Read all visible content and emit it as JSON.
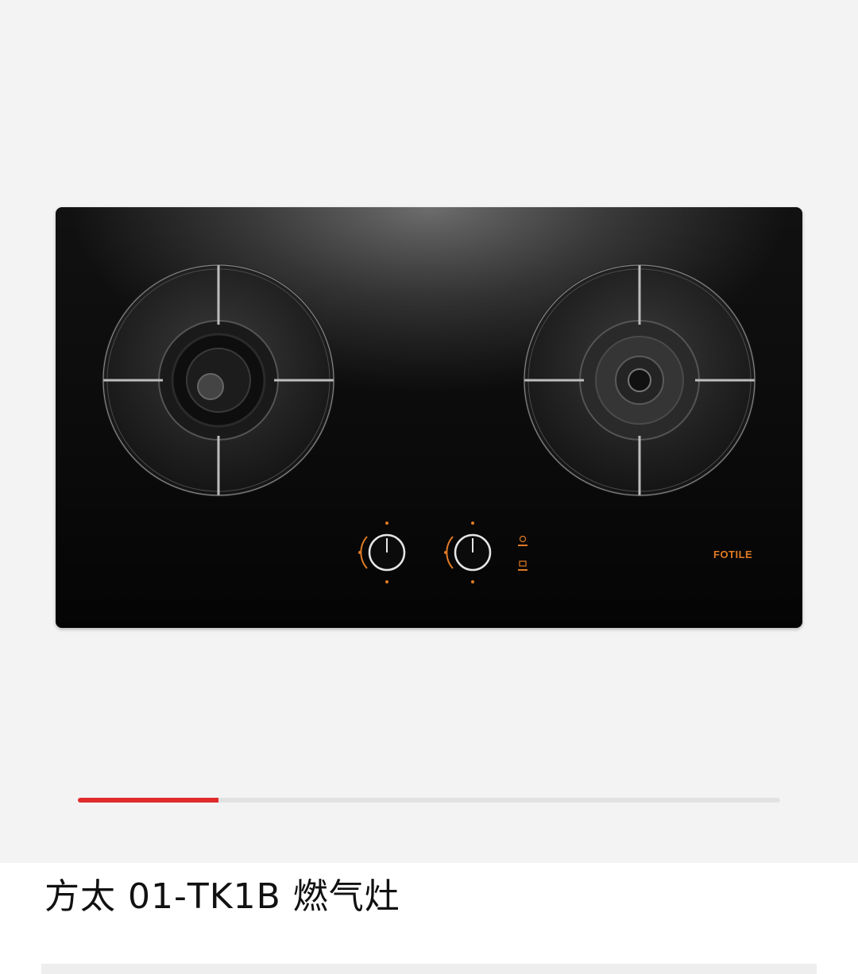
{
  "product": {
    "title": "方太 01-TK1B 燃气灶",
    "brand_logo_text": "FOTILE",
    "image_progress": 0.2
  },
  "colors": {
    "accent": "#e02b2b",
    "brand_orange": "#e07b25",
    "background": "#f3f3f3"
  },
  "icons": [
    "burner-left-icon",
    "burner-right-icon",
    "knob-left-icon",
    "knob-right-icon",
    "flame-indicator-icon",
    "timer-indicator-icon"
  ]
}
